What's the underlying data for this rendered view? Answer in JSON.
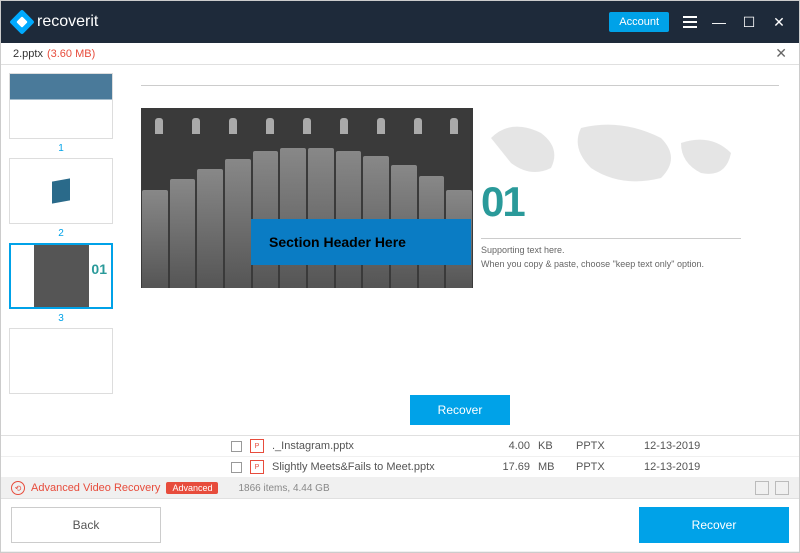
{
  "app": {
    "name": "recoverit",
    "account_label": "Account"
  },
  "file": {
    "name": "2.pptx",
    "size": "(3.60 MB)"
  },
  "thumbs": {
    "selected_num": "3"
  },
  "slide": {
    "section_header": "Section Header Here",
    "number": "01",
    "support1": "Supporting text here.",
    "support2": "When you copy & paste, choose \"keep text only\" option."
  },
  "preview_recover": "Recover",
  "files": [
    {
      "name": "._Instagram.pptx",
      "size": "4.00",
      "unit": "KB",
      "type": "PPTX",
      "date": "12-13-2019"
    },
    {
      "name": "Slightly Meets&Fails to Meet.pptx",
      "size": "17.69",
      "unit": "MB",
      "type": "PPTX",
      "date": "12-13-2019"
    }
  ],
  "status": {
    "avr": "Advanced Video Recovery",
    "badge": "Advanced",
    "summary": "1866 items, 4.44  GB"
  },
  "footer": {
    "back": "Back",
    "recover": "Recover"
  }
}
